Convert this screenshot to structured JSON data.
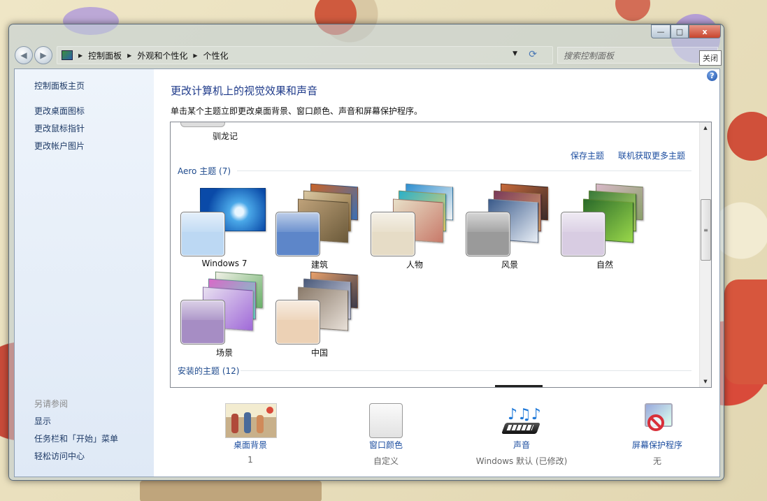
{
  "titlebar": {
    "close_tooltip": "关闭",
    "buttons": {
      "minimize_glyph": "—",
      "maximize_glyph": "□",
      "close_glyph": "x"
    }
  },
  "nav": {
    "back_glyph": "◀",
    "forward_glyph": "▶",
    "crumbs": [
      "控制面板",
      "外观和个性化",
      "个性化"
    ],
    "separator": "▶",
    "dropdown_glyph": "▼",
    "refresh_glyph": "⟳",
    "search_placeholder": "搜索控制面板"
  },
  "sidebar": {
    "home": "控制面板主页",
    "links": [
      "更改桌面图标",
      "更改鼠标指针",
      "更改帐户图片"
    ],
    "see_also_heading": "另请参阅",
    "see_also": [
      "显示",
      "任务栏和「开始」菜单",
      "轻松访问中心"
    ]
  },
  "help_glyph": "?",
  "main": {
    "title": "更改计算机上的视觉效果和声音",
    "subtitle": "单击某个主题立即更改桌面背景、窗口颜色、声音和屏幕保护程序。"
  },
  "themes": {
    "previous_theme_name": "驯龙记",
    "save_theme": "保存主题",
    "get_more_online": "联机获取更多主题",
    "aero_heading": "Aero 主题 (7)",
    "aero": [
      {
        "name": "Windows 7",
        "color": "#bcd8f3"
      },
      {
        "name": "建筑",
        "color": "#5d86c9"
      },
      {
        "name": "人物",
        "color": "#e6dcc6"
      },
      {
        "name": "风景",
        "color": "#9a9a9a"
      },
      {
        "name": "自然",
        "color": "#d8cce2"
      },
      {
        "name": "场景",
        "color": "#a68dc4"
      },
      {
        "name": "中国",
        "color": "#ecd1b5"
      }
    ],
    "installed_heading": "安装的主题 (12)",
    "scroll_up": "▲",
    "scroll_down": "▼",
    "scroll_grip": "≡"
  },
  "bottom": [
    {
      "label": "桌面背景",
      "value": "1",
      "icon": "desktop-background-icon"
    },
    {
      "label": "窗口颜色",
      "value": "自定义",
      "icon": "window-color-icon"
    },
    {
      "label": "声音",
      "value": "Windows 默认 (已修改)",
      "icon": "sound-icon"
    },
    {
      "label": "屏幕保护程序",
      "value": "无",
      "icon": "screensaver-icon"
    }
  ]
}
